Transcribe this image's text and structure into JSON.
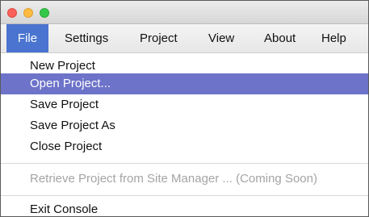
{
  "window": {
    "traffic_lights": {
      "close_color": "#fc605b",
      "minimize_color": "#fdbc40",
      "maximize_color": "#34c84a"
    }
  },
  "menubar": {
    "items": [
      {
        "label": "File",
        "active": true
      },
      {
        "label": "Settings"
      },
      {
        "label": "Project"
      },
      {
        "label": "View"
      },
      {
        "label": "About"
      },
      {
        "label": "Help"
      }
    ],
    "active_color": "#4a74cf"
  },
  "file_menu": {
    "items": [
      {
        "label": "New Project"
      },
      {
        "label": "Open Project...",
        "highlighted": true
      },
      {
        "label": "Save Project"
      },
      {
        "label": "Save Project As"
      },
      {
        "label": "Close Project"
      },
      {
        "label": "Retrieve Project from Site Manager ... (Coming Soon)",
        "disabled": true
      },
      {
        "label": "Exit Console"
      }
    ],
    "highlight_color": "#6d73c9"
  }
}
